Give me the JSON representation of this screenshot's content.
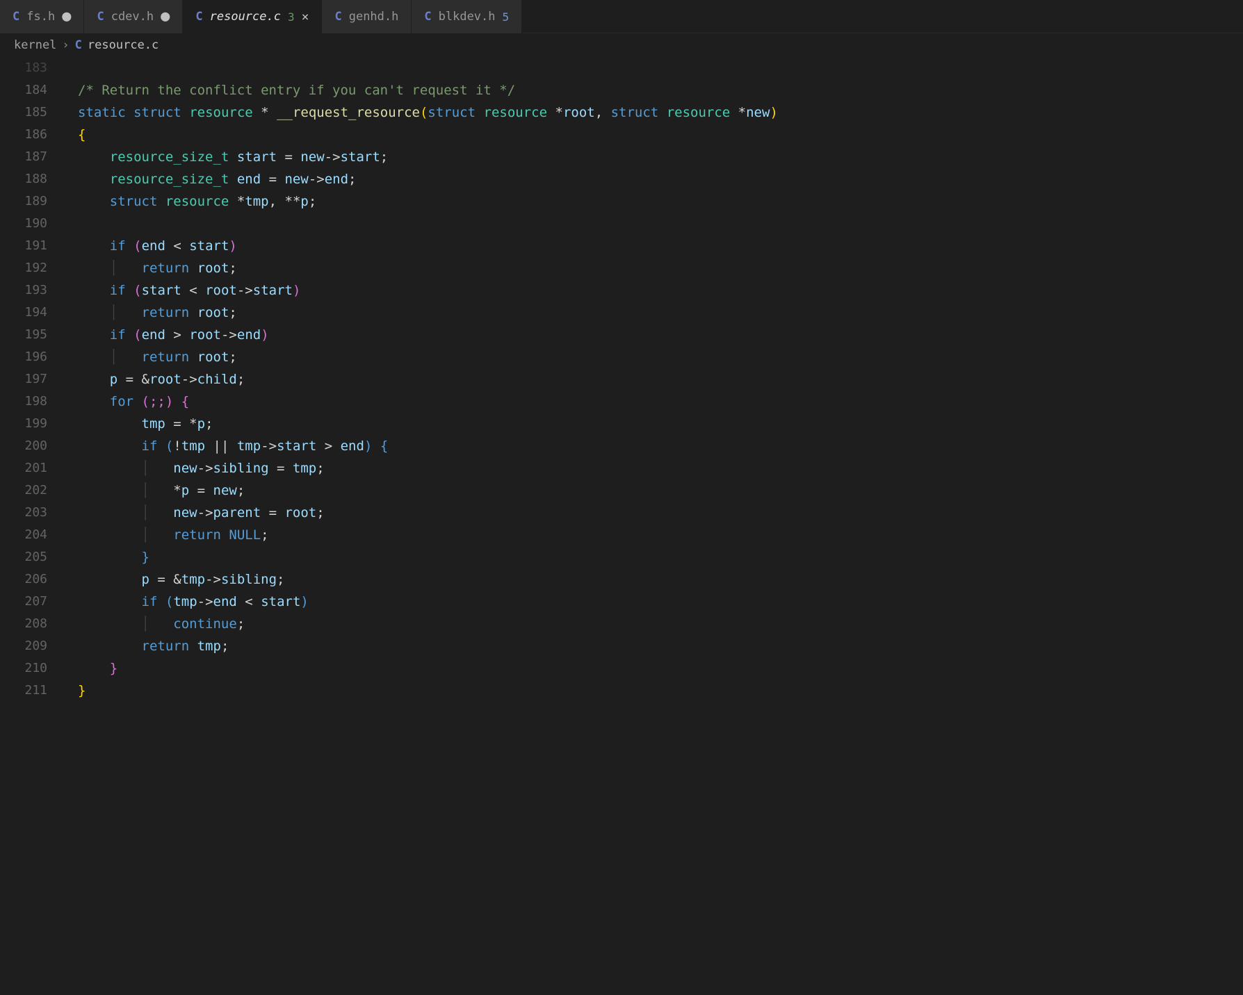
{
  "tabs": [
    {
      "icon": "C",
      "filename": "fs.h",
      "modified": true,
      "active": false,
      "badge": ""
    },
    {
      "icon": "C",
      "filename": "cdev.h",
      "modified": true,
      "active": false,
      "badge": ""
    },
    {
      "icon": "C",
      "filename": "resource.c",
      "modified": false,
      "active": true,
      "badge": "3",
      "badgeClass": "green",
      "closable": true
    },
    {
      "icon": "C",
      "filename": "genhd.h",
      "modified": false,
      "active": false,
      "badge": ""
    },
    {
      "icon": "C",
      "filename": "blkdev.h",
      "modified": false,
      "active": false,
      "badge": "5",
      "badgeClass": "blue"
    }
  ],
  "breadcrumb": {
    "folder": "kernel",
    "sep": "›",
    "icon": "C",
    "file": "resource.c"
  },
  "lines": {
    "start_faded": "183",
    "l184": "184",
    "l185": "185",
    "l186": "186",
    "l187": "187",
    "l188": "188",
    "l189": "189",
    "l190": "190",
    "l191": "191",
    "l192": "192",
    "l193": "193",
    "l194": "194",
    "l195": "195",
    "l196": "196",
    "l197": "197",
    "l198": "198",
    "l199": "199",
    "l200": "200",
    "l201": "201",
    "l202": "202",
    "l203": "203",
    "l204": "204",
    "l205": "205",
    "l206": "206",
    "l207": "207",
    "l208": "208",
    "l209": "209",
    "l210": "210",
    "l211": "211"
  },
  "tok": {
    "comment_184": "/* Return the conflict entry if you can't request it */",
    "static": "static",
    "struct": "struct",
    "resource": "resource",
    "star": "*",
    "fn": "__request_resource",
    "root": "root",
    "new": "new",
    "lbrace": "{",
    "rbrace": "}",
    "resource_size_t": "resource_size_t",
    "start": "start",
    "end": "end",
    "eq": " = ",
    "arrow": "->",
    "semi": ";",
    "tmp": "tmp",
    "dblstar": "**",
    "p": "p",
    "comma": ", ",
    "if": "if",
    "lt": " < ",
    "gt": " > ",
    "return": "return",
    "amp": "&",
    "child": "child",
    "for": "for",
    "forcond": " (;;) ",
    "sibling": "sibling",
    "parent": "parent",
    "NULL": "NULL",
    "continue": "continue",
    "not": "!",
    "or": " || ",
    "lparen": "(",
    "rparen": ")",
    "space": " ",
    "ind1": "    ",
    "ind2": "        ",
    "ind3": "            ",
    "guide": "│"
  }
}
